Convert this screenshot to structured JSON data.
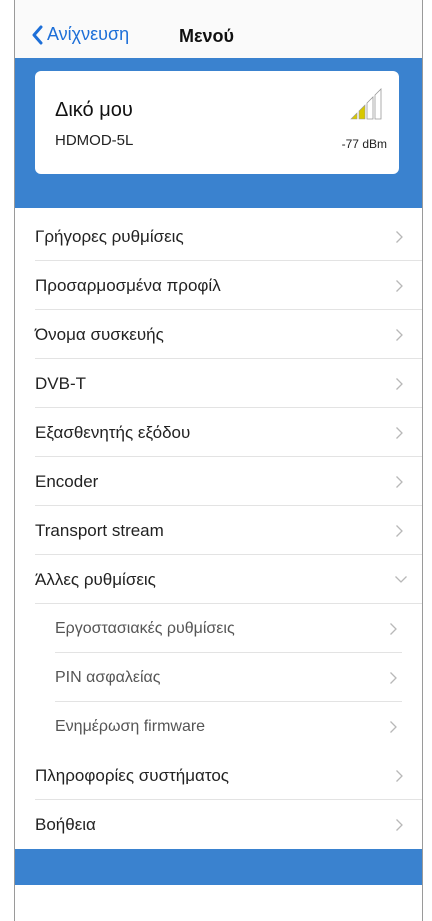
{
  "nav": {
    "back_label": "Ανίχνευση",
    "title": "Μενού"
  },
  "device": {
    "name": "Δικό μου",
    "model": "HDMOD-5L",
    "signal": "-77 dBm",
    "signal_bars_active": 2,
    "signal_bars_total": 4
  },
  "menu": {
    "items": [
      {
        "label": "Γρήγορες ρυθμίσεις"
      },
      {
        "label": "Προσαρμοσμένα προφίλ"
      },
      {
        "label": "Όνομα συσκευής"
      },
      {
        "label": "DVB-T"
      },
      {
        "label": "Εξασθενητής εξόδου"
      },
      {
        "label": "Encoder"
      },
      {
        "label": "Transport stream"
      },
      {
        "label": "Άλλες ρυθμίσεις"
      },
      {
        "label": "Εργοστασιακές ρυθμίσεις"
      },
      {
        "label": "PIN ασφαλείας"
      },
      {
        "label": "Ενημέρωση firmware"
      },
      {
        "label": "Πληροφορίες συστήματος"
      },
      {
        "label": "Βοήθεια"
      }
    ]
  },
  "colors": {
    "accent": "#3a82cf",
    "link": "#1d6fd8",
    "signal_active": "#d8c800"
  }
}
